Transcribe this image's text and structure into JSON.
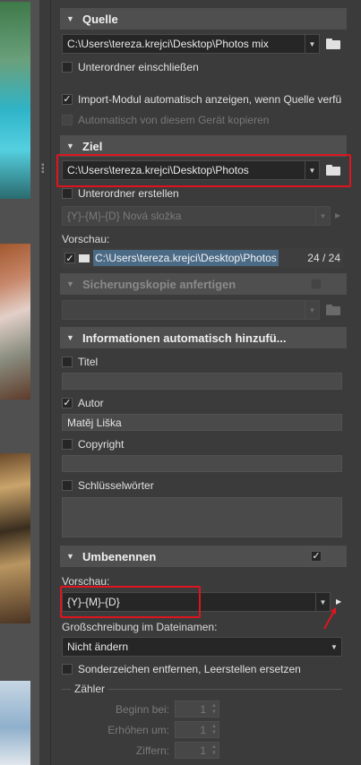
{
  "sections": {
    "quelle": {
      "title": "Quelle",
      "path": "C:\\Users\\tereza.krejci\\Desktop\\Photos mix",
      "subfolders_label": "Unterordner einschließen",
      "auto_show_label": "Import-Modul automatisch anzeigen, wenn Quelle verfü",
      "auto_copy_label": "Automatisch von diesem Gerät kopieren"
    },
    "ziel": {
      "title": "Ziel",
      "path": "C:\\Users\\tereza.krejci\\Desktop\\Photos",
      "create_subfolder_label": "Unterordner erstellen",
      "subfolder_pattern": "{Y}-{M}-{D} Nová složka",
      "preview_label": "Vorschau:",
      "preview_path": "C:\\Users\\tereza.krejci\\Desktop\\Photos",
      "preview_count": "24 / 24"
    },
    "backup": {
      "title": "Sicherungskopie anfertigen"
    },
    "info": {
      "title": "Informationen automatisch hinzufü...",
      "title_label": "Titel",
      "author_label": "Autor",
      "author_value": "Matěj Liška",
      "copyright_label": "Copyright",
      "keywords_label": "Schlüsselwörter"
    },
    "rename": {
      "title": "Umbenennen",
      "preview_label": "Vorschau:",
      "pattern": "{Y}-{M}-{D}",
      "case_label": "Großschreibung im Dateinamen:",
      "case_value": "Nicht ändern",
      "special_chars_label": "Sonderzeichen entfernen, Leerstellen ersetzen",
      "counter_label": "Zähler",
      "start_label": "Beginn bei:",
      "start_value": "1",
      "step_label": "Erhöhen um:",
      "step_value": "1",
      "digits_label": "Ziffern:",
      "digits_value": "1"
    }
  },
  "glyphs": {
    "collapse": "▼",
    "dropdown": "▼",
    "check": "✓",
    "play": "▶"
  },
  "colors": {
    "highlight_frame": "#e0141e",
    "panel_bg": "#3b3b3b",
    "header_bg": "#4f4f4f"
  }
}
